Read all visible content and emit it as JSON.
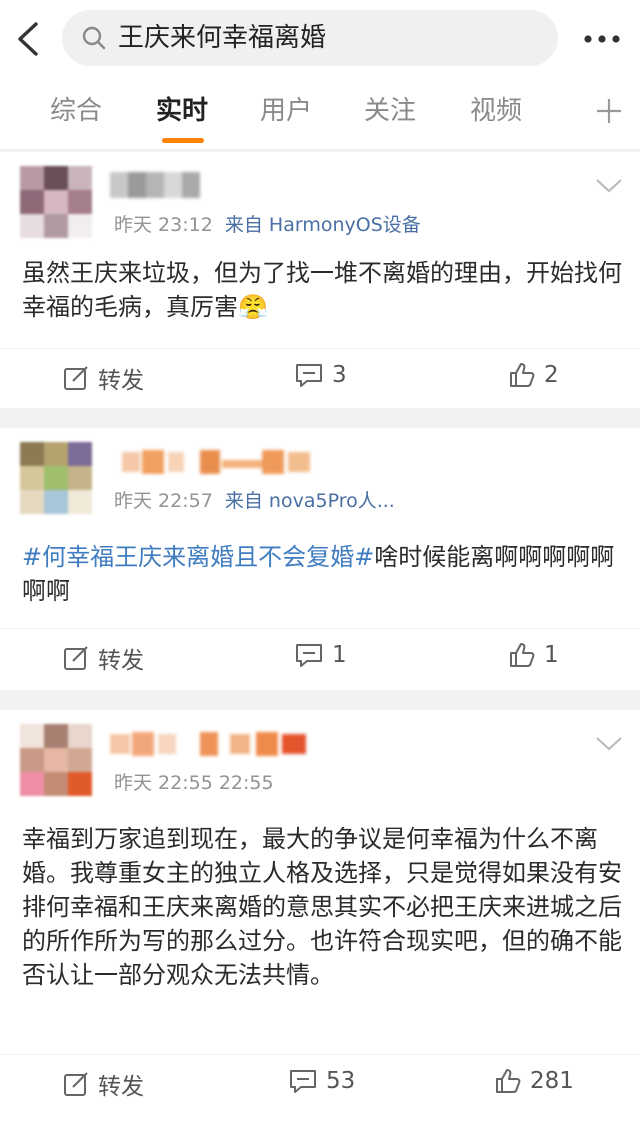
{
  "search": {
    "query": "王庆来何幸福离婚"
  },
  "tabs": [
    {
      "label": "综合"
    },
    {
      "label": "实时"
    },
    {
      "label": "用户"
    },
    {
      "label": "关注"
    },
    {
      "label": "视频"
    }
  ],
  "posts": [
    {
      "time": "昨天 23:12",
      "source": "来自 HarmonyOS设备",
      "text": "虽然王庆来垃圾，但为了找一堆不离婚的理由，开始找何幸福的毛病，真厉害😤",
      "repost_label": "转发",
      "comments": "3",
      "likes": "2"
    },
    {
      "time": "昨天 22:57",
      "source": "来自 nova5Pro人...",
      "topic": "#何幸福王庆来离婚且不会复婚#",
      "text": "啥时候能离啊啊啊啊啊啊啊",
      "repost_label": "转发",
      "comments": "1",
      "likes": "1"
    },
    {
      "time": "昨天 22:55 22:55",
      "source": "",
      "text": "幸福到万家追到现在，最大的争议是何幸福为什么不离婚。我尊重女主的独立人格及选择，只是觉得如果没有安排何幸福和王庆来离婚的意思其实不必把王庆来进城之后的所作所为写的那么过分。也许符合现实吧，但的确不能否认让一部分观众无法共情。",
      "repost_label": "转发",
      "comments": "53",
      "likes": "281"
    }
  ],
  "colors": {
    "accent": "#ff8200",
    "link": "#3f7cc0",
    "meta_source": "#4a6fa5"
  },
  "icons": [
    "back-icon",
    "search-icon",
    "more-icon",
    "plus-icon",
    "chevron-down-icon",
    "repost-icon",
    "comment-icon",
    "like-icon"
  ]
}
